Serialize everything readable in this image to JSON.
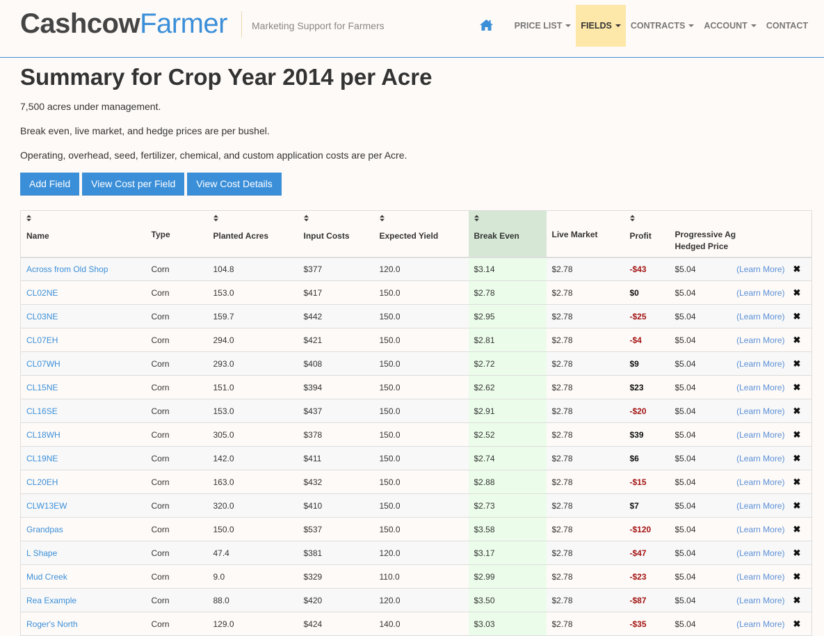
{
  "brand": {
    "part1": "Cashcow",
    "part2": "Farmer",
    "tagline": "Marketing Support for Farmers"
  },
  "nav": {
    "home_icon": "home-icon",
    "items": [
      {
        "label": "PRICE LIST",
        "dropdown": true,
        "active": false
      },
      {
        "label": "FIELDS",
        "dropdown": true,
        "active": true
      },
      {
        "label": "CONTRACTS",
        "dropdown": true,
        "active": false
      },
      {
        "label": "ACCOUNT",
        "dropdown": true,
        "active": false
      },
      {
        "label": "CONTACT",
        "dropdown": false,
        "active": false
      }
    ]
  },
  "page": {
    "title": "Summary for Crop Year 2014 per Acre",
    "info": [
      "7,500 acres under management.",
      "Break even, live market, and hedge prices are per bushel.",
      "Operating, overhead, seed, fertilizer, chemical, and custom application costs are per Acre."
    ],
    "buttons": {
      "add_field": "Add Field",
      "view_cost_per_field": "View Cost per Field",
      "view_cost_details": "View Cost Details"
    }
  },
  "colors": {
    "accent": "#3b8fd9",
    "active_nav": "#fde7a9",
    "negative": "#a31515",
    "break_even_header": "#d6e8d5",
    "break_even_cell": "#ebfdea"
  },
  "table": {
    "columns": [
      {
        "label": "Name",
        "sortable": true
      },
      {
        "label": "Type",
        "sortable": false
      },
      {
        "label": "Planted Acres",
        "sortable": true
      },
      {
        "label": "Input Costs",
        "sortable": true
      },
      {
        "label": "Expected Yield",
        "sortable": true
      },
      {
        "label": "Break Even",
        "sortable": true
      },
      {
        "label": "Live Market",
        "sortable": false
      },
      {
        "label": "Profit",
        "sortable": true
      },
      {
        "label": "Progressive Ag",
        "label2": "Hedged Price",
        "sortable": false
      }
    ],
    "learn_more_label": "(Learn More)",
    "delete_glyph": "✖",
    "rows": [
      {
        "name": "Across from Old Shop",
        "type": "Corn",
        "acres": "104.8",
        "input": "$377",
        "yield": "120.0",
        "break_even": "$3.14",
        "live": "$2.78",
        "profit": "-$43",
        "hedged": "$5.04"
      },
      {
        "name": "CL02NE",
        "type": "Corn",
        "acres": "153.0",
        "input": "$417",
        "yield": "150.0",
        "break_even": "$2.78",
        "live": "$2.78",
        "profit": "$0",
        "hedged": "$5.04"
      },
      {
        "name": "CL03NE",
        "type": "Corn",
        "acres": "159.7",
        "input": "$442",
        "yield": "150.0",
        "break_even": "$2.95",
        "live": "$2.78",
        "profit": "-$25",
        "hedged": "$5.04"
      },
      {
        "name": "CL07EH",
        "type": "Corn",
        "acres": "294.0",
        "input": "$421",
        "yield": "150.0",
        "break_even": "$2.81",
        "live": "$2.78",
        "profit": "-$4",
        "hedged": "$5.04"
      },
      {
        "name": "CL07WH",
        "type": "Corn",
        "acres": "293.0",
        "input": "$408",
        "yield": "150.0",
        "break_even": "$2.72",
        "live": "$2.78",
        "profit": "$9",
        "hedged": "$5.04"
      },
      {
        "name": "CL15NE",
        "type": "Corn",
        "acres": "151.0",
        "input": "$394",
        "yield": "150.0",
        "break_even": "$2.62",
        "live": "$2.78",
        "profit": "$23",
        "hedged": "$5.04"
      },
      {
        "name": "CL16SE",
        "type": "Corn",
        "acres": "153.0",
        "input": "$437",
        "yield": "150.0",
        "break_even": "$2.91",
        "live": "$2.78",
        "profit": "-$20",
        "hedged": "$5.04"
      },
      {
        "name": "CL18WH",
        "type": "Corn",
        "acres": "305.0",
        "input": "$378",
        "yield": "150.0",
        "break_even": "$2.52",
        "live": "$2.78",
        "profit": "$39",
        "hedged": "$5.04"
      },
      {
        "name": "CL19NE",
        "type": "Corn",
        "acres": "142.0",
        "input": "$411",
        "yield": "150.0",
        "break_even": "$2.74",
        "live": "$2.78",
        "profit": "$6",
        "hedged": "$5.04"
      },
      {
        "name": "CL20EH",
        "type": "Corn",
        "acres": "163.0",
        "input": "$432",
        "yield": "150.0",
        "break_even": "$2.88",
        "live": "$2.78",
        "profit": "-$15",
        "hedged": "$5.04"
      },
      {
        "name": "CLW13EW",
        "type": "Corn",
        "acres": "320.0",
        "input": "$410",
        "yield": "150.0",
        "break_even": "$2.73",
        "live": "$2.78",
        "profit": "$7",
        "hedged": "$5.04"
      },
      {
        "name": "Grandpas",
        "type": "Corn",
        "acres": "150.0",
        "input": "$537",
        "yield": "150.0",
        "break_even": "$3.58",
        "live": "$2.78",
        "profit": "-$120",
        "hedged": "$5.04"
      },
      {
        "name": "L Shape",
        "type": "Corn",
        "acres": "47.4",
        "input": "$381",
        "yield": "120.0",
        "break_even": "$3.17",
        "live": "$2.78",
        "profit": "-$47",
        "hedged": "$5.04"
      },
      {
        "name": "Mud Creek",
        "type": "Corn",
        "acres": "9.0",
        "input": "$329",
        "yield": "110.0",
        "break_even": "$2.99",
        "live": "$2.78",
        "profit": "-$23",
        "hedged": "$5.04"
      },
      {
        "name": "Rea Example",
        "type": "Corn",
        "acres": "88.0",
        "input": "$420",
        "yield": "120.0",
        "break_even": "$3.50",
        "live": "$2.78",
        "profit": "-$87",
        "hedged": "$5.04"
      },
      {
        "name": "Roger's North",
        "type": "Corn",
        "acres": "129.0",
        "input": "$424",
        "yield": "140.0",
        "break_even": "$3.03",
        "live": "$2.78",
        "profit": "-$35",
        "hedged": "$5.04"
      }
    ]
  }
}
